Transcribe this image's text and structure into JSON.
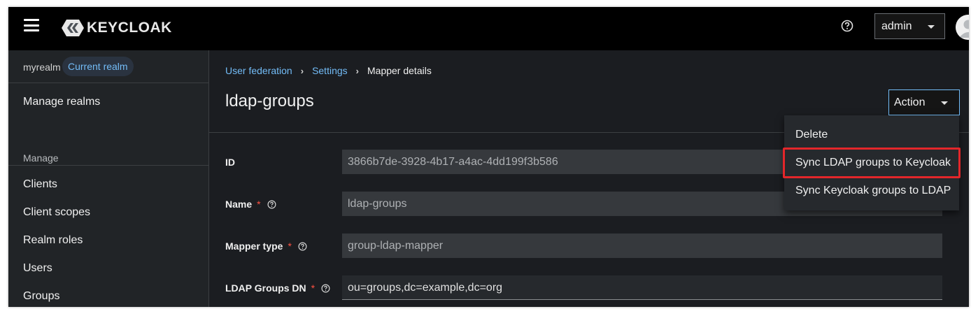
{
  "masthead": {
    "brand": "KEYCLOAK",
    "user_menu": "admin"
  },
  "sidebar": {
    "realm_name": "myrealm",
    "realm_badge": "Current realm",
    "manage_realms": "Manage realms",
    "section_manage": "Manage",
    "items": [
      {
        "label": "Clients"
      },
      {
        "label": "Client scopes"
      },
      {
        "label": "Realm roles"
      },
      {
        "label": "Users"
      },
      {
        "label": "Groups"
      }
    ]
  },
  "breadcrumb": {
    "items": [
      "User federation",
      "Settings"
    ],
    "current": "Mapper details"
  },
  "page": {
    "title": "ldap-groups",
    "action_label": "Action"
  },
  "action_menu": {
    "items": [
      {
        "label": "Delete"
      },
      {
        "label": "Sync LDAP groups to Keycloak"
      },
      {
        "label": "Sync Keycloak groups to LDAP"
      }
    ],
    "highlighted_index": 1,
    "highlight_color": "#e3262a"
  },
  "form": {
    "fields": [
      {
        "label": "ID",
        "value": "3866b7de-3928-4b17-a4ac-4dd199f3b586",
        "required": false
      },
      {
        "label": "Name",
        "value": "ldap-groups",
        "required": true
      },
      {
        "label": "Mapper type",
        "value": "group-ldap-mapper",
        "required": true
      },
      {
        "label": "LDAP Groups DN",
        "value": "ou=groups,dc=example,dc=org",
        "required": true
      }
    ],
    "required_marker": "*"
  },
  "colors": {
    "link": "#73bcf7",
    "background": "#1b1d21",
    "masthead": "#000000",
    "required": "#fe5142"
  }
}
